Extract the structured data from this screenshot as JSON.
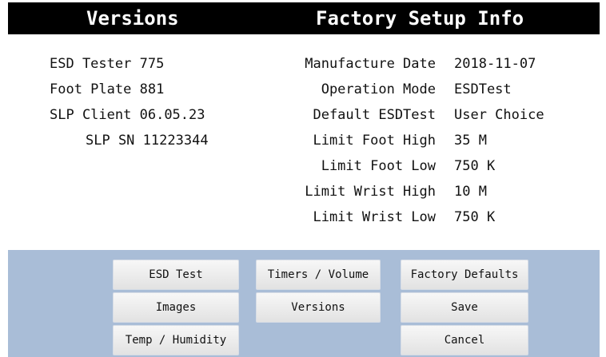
{
  "header": {
    "left_title": "Versions",
    "right_title": "Factory Setup Info"
  },
  "versions": [
    {
      "label": "ESD Tester",
      "value": "775"
    },
    {
      "label": "Foot Plate",
      "value": "881"
    },
    {
      "label": "SLP Client",
      "value": "06.05.23"
    },
    {
      "label": "SLP SN",
      "value": "11223344"
    }
  ],
  "factory": [
    {
      "label": "Manufacture Date",
      "value": "2018-11-07"
    },
    {
      "label": "Operation Mode",
      "value": "ESDTest"
    },
    {
      "label": "Default ESDTest",
      "value": "User Choice"
    },
    {
      "label": "Limit Foot High",
      "value": "35 M"
    },
    {
      "label": "Limit Foot Low",
      "value": "750 K"
    },
    {
      "label": "Limit Wrist High",
      "value": "10 M"
    },
    {
      "label": "Limit Wrist Low",
      "value": "750 K"
    }
  ],
  "buttons": {
    "esd_test": "ESD Test",
    "images": "Images",
    "temp_humidity": "Temp / Humidity",
    "timers_volume": "Timers / Volume",
    "versions": "Versions",
    "factory_defaults": "Factory Defaults",
    "save": "Save",
    "cancel": "Cancel"
  }
}
